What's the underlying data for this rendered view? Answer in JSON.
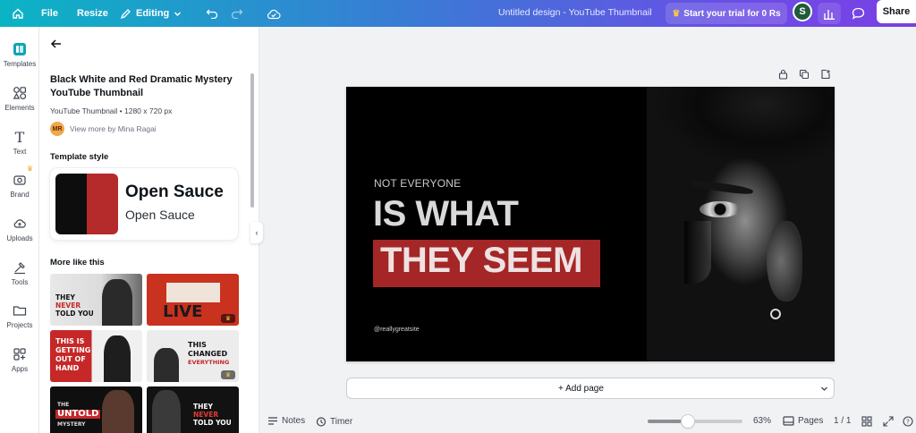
{
  "topbar": {
    "file": "File",
    "resize": "Resize",
    "editing": "Editing",
    "doc_title": "Untitled design - YouTube Thumbnail",
    "trial": "Start your trial for 0 Rs",
    "avatar": "S",
    "share": "Share"
  },
  "rail": {
    "items": [
      {
        "label": "Templates",
        "icon": "templates-icon"
      },
      {
        "label": "Elements",
        "icon": "elements-icon"
      },
      {
        "label": "Text",
        "icon": "text-icon"
      },
      {
        "label": "Brand",
        "icon": "brand-icon"
      },
      {
        "label": "Uploads",
        "icon": "uploads-icon"
      },
      {
        "label": "Tools",
        "icon": "tools-icon"
      },
      {
        "label": "Projects",
        "icon": "projects-icon"
      },
      {
        "label": "Apps",
        "icon": "apps-icon"
      }
    ]
  },
  "panel": {
    "title": "Black White and Red Dramatic Mystery YouTube Thumbnail",
    "meta": "YouTube Thumbnail • 1280 x 720 px",
    "author_initials": "MR",
    "author": "View more by Mina Ragai",
    "style_label": "Template style",
    "font_heading": "Open Sauce",
    "font_body": "Open Sauce",
    "more_label": "More like this",
    "thumbs": [
      {
        "lines": [
          "THEY",
          "NEVER",
          "TOLD YOU"
        ]
      },
      {
        "lines": [
          "LIVE"
        ]
      },
      {
        "lines": [
          "THIS IS",
          "GETTING",
          "OUT OF",
          "HAND"
        ]
      },
      {
        "lines": [
          "THIS",
          "CHANGED",
          "EVERYTHING"
        ]
      },
      {
        "lines": [
          "THE",
          "UNTOLD",
          "MYSTERY"
        ]
      },
      {
        "lines": [
          "THEY",
          "NEVER",
          "TOLD YOU"
        ]
      }
    ]
  },
  "design": {
    "subtitle": "NOT EVERYONE",
    "headline": "IS WHAT",
    "highlight": "THEY SEEM",
    "handle": "@reallygreatsite"
  },
  "canvas": {
    "add_page": "+ Add page"
  },
  "bottombar": {
    "notes": "Notes",
    "timer": "Timer",
    "zoom": "63%",
    "zoom_level": 0.42,
    "pages": "Pages",
    "page_count": "1 / 1"
  },
  "colors": {
    "accent_red": "#a42626",
    "brand_gradient_start": "#0bb4c4",
    "brand_gradient_end": "#7b3fe4"
  }
}
